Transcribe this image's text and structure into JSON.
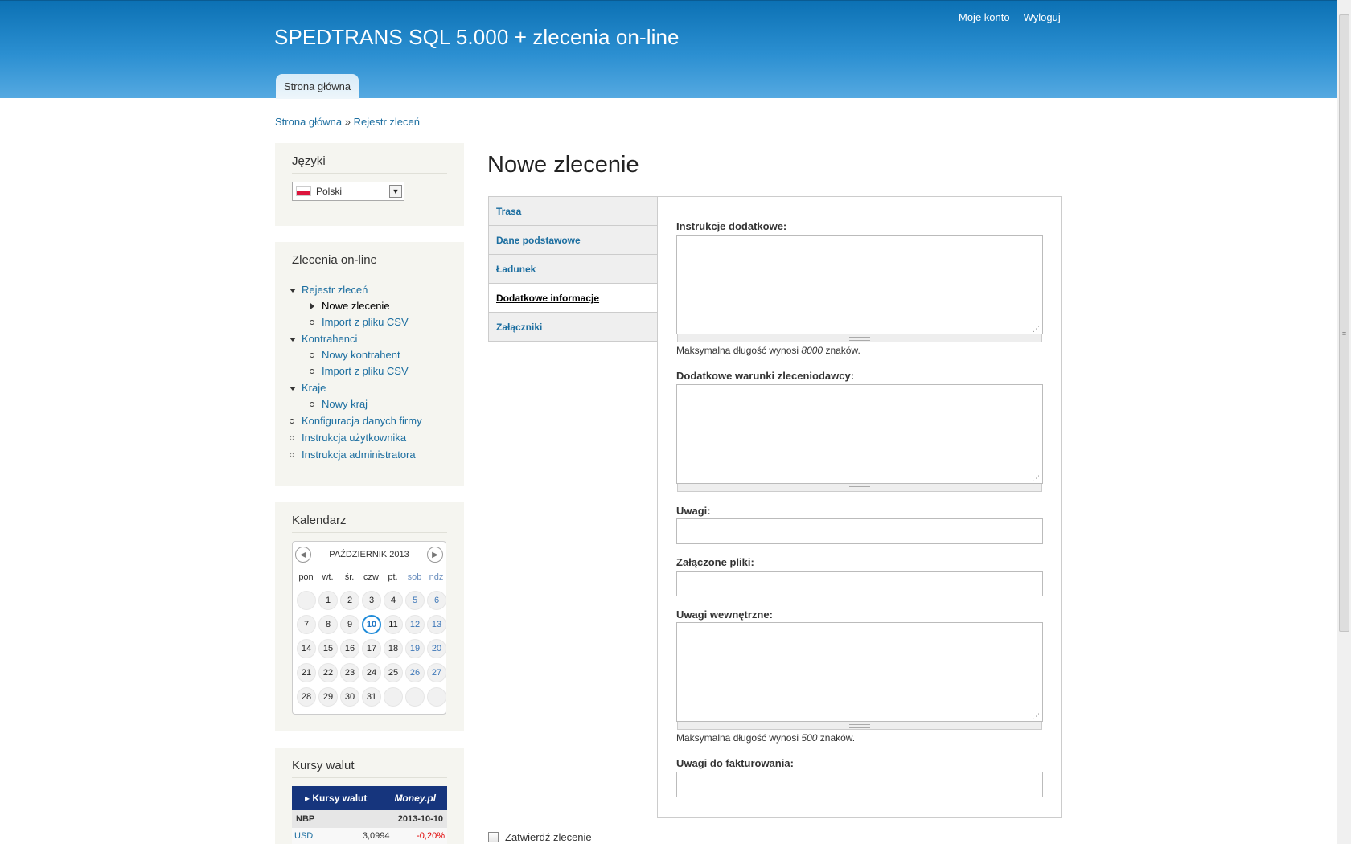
{
  "header": {
    "site_name": "SPEDTRANS SQL 5.000 + zlecenia on-line",
    "secondary_menu": [
      "Moje konto",
      "Wyloguj"
    ],
    "main_tab": "Strona główna"
  },
  "breadcrumb": {
    "items": [
      "Strona główna",
      "Rejestr zleceń"
    ],
    "separator": "»"
  },
  "sidebar": {
    "languages": {
      "title": "Języki",
      "selected": "Polski"
    },
    "orders": {
      "title": "Zlecenia on-line",
      "items": [
        {
          "label": "Rejestr zleceń",
          "children": [
            "Nowe zlecenie",
            "Import z pliku CSV"
          ]
        },
        {
          "label": "Kontrahenci",
          "children": [
            "Nowy kontrahent",
            "Import z pliku CSV"
          ]
        },
        {
          "label": "Kraje",
          "children": [
            "Nowy kraj"
          ]
        },
        {
          "label": "Konfiguracja danych firmy"
        },
        {
          "label": "Instrukcja użytkownika"
        },
        {
          "label": "Instrukcja administratora"
        }
      ]
    },
    "calendar": {
      "title": "Kalendarz",
      "month": "PAŹDZIERNIK 2013",
      "weekdays": [
        "pon",
        "wt.",
        "śr.",
        "czw",
        "pt.",
        "sob",
        "ndz"
      ],
      "today": "10"
    },
    "currency": {
      "title": "Kursy walut",
      "widget_title": "Kursy walut",
      "provider": "Money.pl",
      "source": "NBP",
      "date": "2013-10-10",
      "rows": [
        {
          "code": "USD",
          "rate": "3,0994",
          "change": "-0,20%"
        }
      ]
    }
  },
  "main": {
    "title": "Nowe zlecenie",
    "tabs": [
      "Trasa",
      "Dane podstawowe",
      "Ładunek",
      "Dodatkowe informacje",
      "Załączniki"
    ],
    "selected_tab": "Dodatkowe informacje",
    "fields": {
      "instructions_label": "Instrukcje dodatkowe:",
      "instructions_desc_prefix": "Maksymalna długość wynosi",
      "instructions_max": "8000",
      "instructions_desc_suffix": "znaków.",
      "conditions_label": "Dodatkowe warunki zleceniodawcy:",
      "remarks_label": "Uwagi:",
      "attached_label": "Załączone pliki:",
      "internal_label": "Uwagi wewnętrzne:",
      "internal_desc_prefix": "Maksymalna długość wynosi",
      "internal_max": "500",
      "internal_desc_suffix": "znaków.",
      "invoicing_label": "Uwagi do fakturowania:"
    },
    "confirm_label": "Zatwierdź zlecenie"
  }
}
